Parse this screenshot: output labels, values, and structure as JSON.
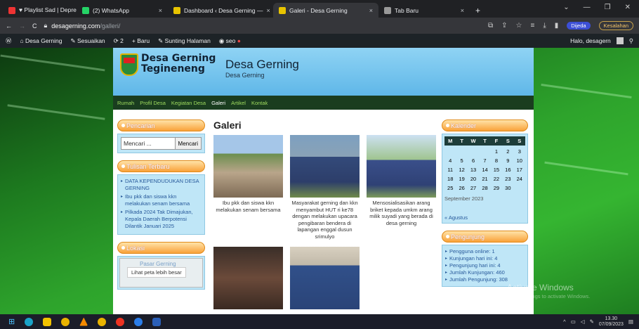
{
  "browser": {
    "tabs": [
      {
        "label": "♥ Playlist Sad | Depres ◀)",
        "color": "#e33"
      },
      {
        "label": "(2) WhatsApp",
        "color": "#25d366"
      },
      {
        "label": "Dashboard ‹ Desa Gerning —",
        "color": "#e8c400"
      },
      {
        "label": "Galeri - Desa Gerning",
        "color": "#e8c400",
        "active": true
      },
      {
        "label": "Tab Baru",
        "color": "#999"
      }
    ],
    "new_tab": "+",
    "close_glyph": "×",
    "domain": "desagerning.com",
    "path": "/galleri/",
    "profile_label": "Dijeda",
    "error_label": "Kesalahan"
  },
  "wpbar": {
    "site": "Desa Gerning",
    "customize": "Sesuaikan",
    "updates": "2",
    "new": "Baru",
    "edit": "Sunting Halaman",
    "seo": "seo",
    "greeting": "Halo, desagern"
  },
  "site": {
    "brand_line1": "Desa Gerning",
    "brand_line2": "Tegineneng",
    "title": "Desa Gerning",
    "tagline": "Desa Gerning",
    "nav": [
      "Rumah",
      "Profil Desa",
      "Kegiatan Desa",
      "Galeri",
      "Artikel",
      "Kontak"
    ],
    "nav_current": 3
  },
  "sidebar_left": {
    "search_title": "Pencarian",
    "search_placeholder": "Mencari ...",
    "search_button": "Mencari",
    "recent_title": "Tulisan Terbaru",
    "recent_posts": [
      "DATA KEPENDUDUKAN DESA GERNING",
      "Ibu pkk dan siswa kkn melakukan senam bersama",
      "Pilkada 2024 Tak Dimajukan, Kepala Daerah Berpotensi Dilantik Januari 2025"
    ],
    "location_title": "Lokasi",
    "map_label": "Pasar Gerning",
    "map_button": "Lihat peta lebih besar"
  },
  "main": {
    "heading": "Galeri",
    "items": [
      {
        "caption": "Ibu pkk dan siswa kkn melakukan senam bersama"
      },
      {
        "caption": "Masyarakat gerning dan kkn menyambut HUT ri ke78 dengan melakukan upacara pengibaran bendera di lapangan enggal dusun srimulyo"
      },
      {
        "caption": "Mensosialisasikan arang briket kepada umkm arang milik suyadi yang berada di desa gerning"
      },
      {
        "caption": ""
      },
      {
        "caption": ""
      }
    ]
  },
  "sidebar_right": {
    "calendar_title": "Kalender",
    "weekdays": [
      "M",
      "T",
      "W",
      "T",
      "F",
      "S",
      "S"
    ],
    "days": [
      "",
      "",
      "",
      "",
      "1",
      "2",
      "3",
      "4",
      "5",
      "6",
      "7",
      "8",
      "9",
      "10",
      "11",
      "12",
      "13",
      "14",
      "15",
      "16",
      "17",
      "18",
      "19",
      "20",
      "21",
      "22",
      "23",
      "24",
      "25",
      "26",
      "27",
      "28",
      "29",
      "30",
      ""
    ],
    "month": "September 2023",
    "prev": "« Agustus",
    "visitors_title": "Pengunjung",
    "stats": [
      "Pengguna online: 1",
      "Kunjungan hari ini: 4",
      "Pengunjung hari ini: 4",
      "Jumlah Kunjungan: 460",
      "Jumlah Pengunjung: 308"
    ]
  },
  "windows": {
    "watermark": "Activate Windows",
    "watermark_sub": "Go to Settings to activate Windows.",
    "time": "13.30",
    "date": "07/09/2023"
  }
}
